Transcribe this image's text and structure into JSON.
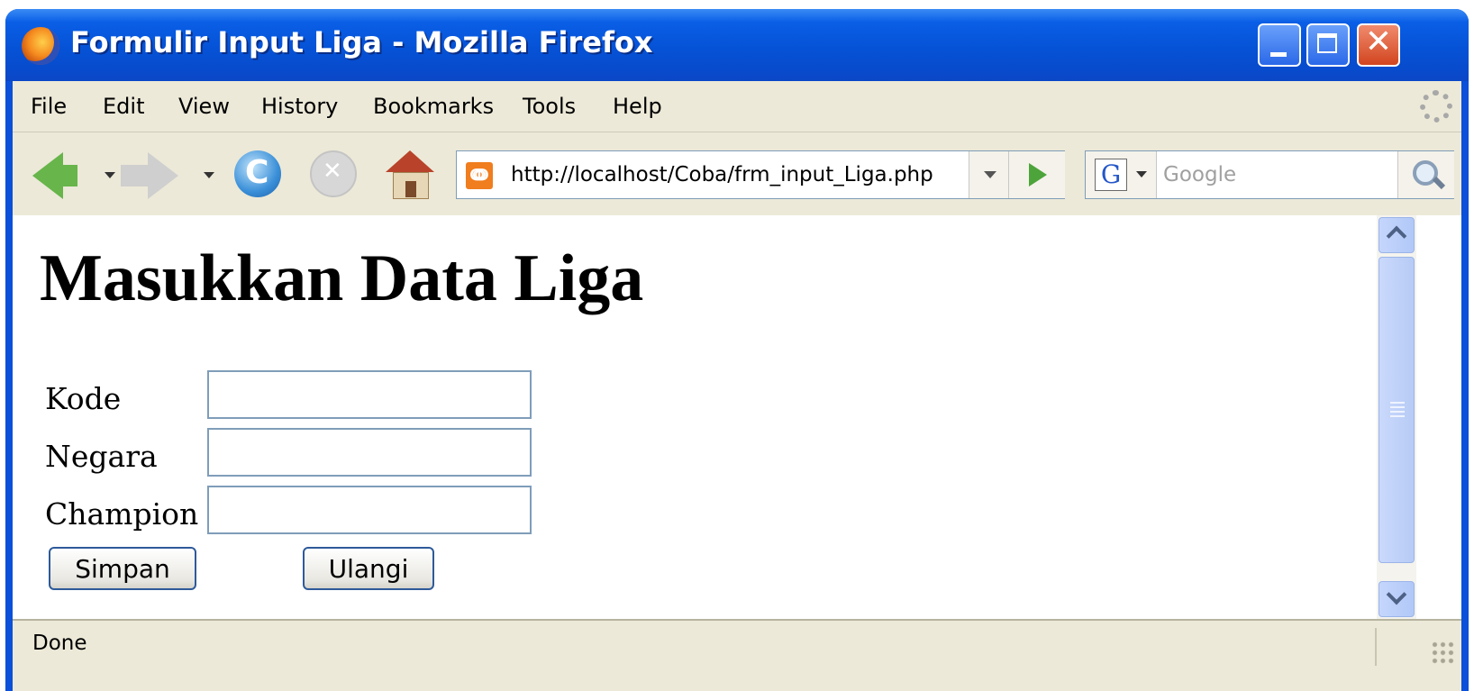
{
  "window": {
    "title": "Formulir Input Liga - Mozilla Firefox"
  },
  "menu": {
    "items": [
      "File",
      "Edit",
      "View",
      "History",
      "Bookmarks",
      "Tools",
      "Help"
    ]
  },
  "navbar": {
    "url": "http://localhost/Coba/frm_input_Liga.php",
    "search_engine": "G",
    "search_placeholder": "Google"
  },
  "page": {
    "title": "Masukkan Data Liga",
    "fields": [
      {
        "label": "Kode",
        "value": ""
      },
      {
        "label": "Negara",
        "value": ""
      },
      {
        "label": "Champion",
        "value": ""
      }
    ],
    "buttons": {
      "submit": "Simpan",
      "reset": "Ulangi"
    }
  },
  "status": {
    "text": "Done"
  },
  "colors": {
    "titlebar": "#0552d6",
    "chrome": "#ece9d8",
    "input_border": "#7f9db9"
  }
}
